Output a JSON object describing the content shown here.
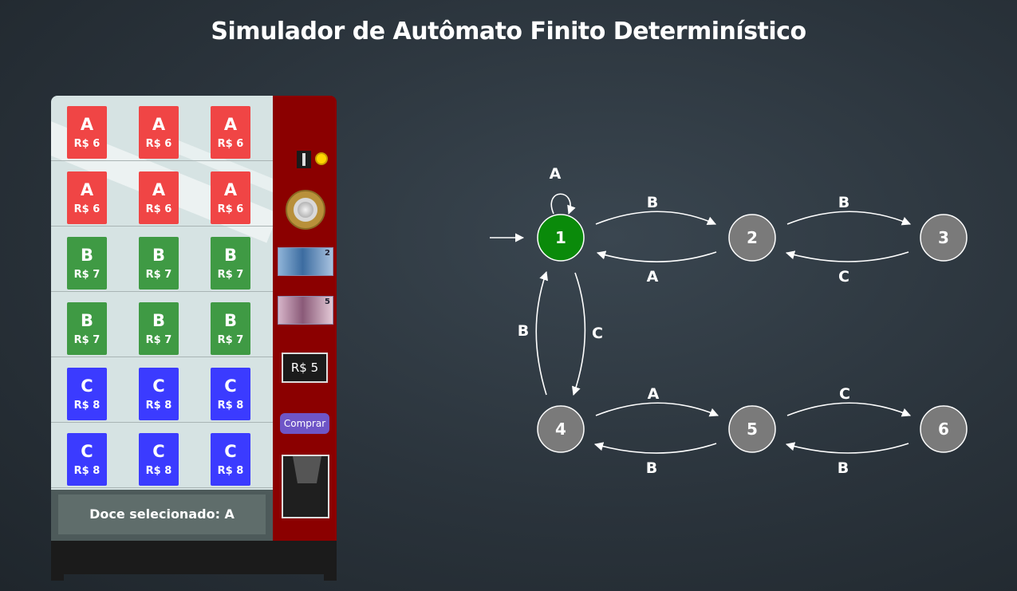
{
  "title": "Simulador de Autômato Finito Determinístico",
  "machine": {
    "products": [
      {
        "letter": "A",
        "price": "R$ 6",
        "color": "#f04545"
      },
      {
        "letter": "A",
        "price": "R$ 6",
        "color": "#f04545"
      },
      {
        "letter": "A",
        "price": "R$ 6",
        "color": "#f04545"
      },
      {
        "letter": "A",
        "price": "R$ 6",
        "color": "#f04545"
      },
      {
        "letter": "A",
        "price": "R$ 6",
        "color": "#f04545"
      },
      {
        "letter": "A",
        "price": "R$ 6",
        "color": "#f04545"
      },
      {
        "letter": "B",
        "price": "R$ 7",
        "color": "#3f9a44"
      },
      {
        "letter": "B",
        "price": "R$ 7",
        "color": "#3f9a44"
      },
      {
        "letter": "B",
        "price": "R$ 7",
        "color": "#3f9a44"
      },
      {
        "letter": "B",
        "price": "R$ 7",
        "color": "#3f9a44"
      },
      {
        "letter": "B",
        "price": "R$ 7",
        "color": "#3f9a44"
      },
      {
        "letter": "B",
        "price": "R$ 7",
        "color": "#3f9a44"
      },
      {
        "letter": "C",
        "price": "R$ 8",
        "color": "#3b3bff"
      },
      {
        "letter": "C",
        "price": "R$ 8",
        "color": "#3b3bff"
      },
      {
        "letter": "C",
        "price": "R$ 8",
        "color": "#3b3bff"
      },
      {
        "letter": "C",
        "price": "R$ 8",
        "color": "#3b3bff"
      },
      {
        "letter": "C",
        "price": "R$ 8",
        "color": "#3b3bff"
      },
      {
        "letter": "C",
        "price": "R$ 8",
        "color": "#3b3bff"
      }
    ],
    "selected_label": "Doce selecionado: A",
    "note2_value": "2",
    "note5_value": "5",
    "balance": "R$ 5",
    "buy_label": "Comprar"
  },
  "automaton": {
    "states": [
      {
        "id": "1",
        "label": "1",
        "active": true,
        "color": "#0a8a0a"
      },
      {
        "id": "2",
        "label": "2",
        "active": false,
        "color": "#7a7a7a"
      },
      {
        "id": "3",
        "label": "3",
        "active": false,
        "color": "#7a7a7a"
      },
      {
        "id": "4",
        "label": "4",
        "active": false,
        "color": "#7a7a7a"
      },
      {
        "id": "5",
        "label": "5",
        "active": false,
        "color": "#7a7a7a"
      },
      {
        "id": "6",
        "label": "6",
        "active": false,
        "color": "#7a7a7a"
      }
    ],
    "initial_state": "1",
    "transitions": [
      {
        "from": "1",
        "to": "1",
        "label": "A"
      },
      {
        "from": "1",
        "to": "2",
        "label": "B"
      },
      {
        "from": "2",
        "to": "1",
        "label": "A"
      },
      {
        "from": "2",
        "to": "3",
        "label": "B"
      },
      {
        "from": "3",
        "to": "2",
        "label": "C"
      },
      {
        "from": "1",
        "to": "4",
        "label": "C"
      },
      {
        "from": "4",
        "to": "1",
        "label": "B"
      },
      {
        "from": "4",
        "to": "5",
        "label": "A"
      },
      {
        "from": "5",
        "to": "4",
        "label": "B"
      },
      {
        "from": "5",
        "to": "6",
        "label": "C"
      },
      {
        "from": "6",
        "to": "5",
        "label": "B"
      }
    ]
  }
}
